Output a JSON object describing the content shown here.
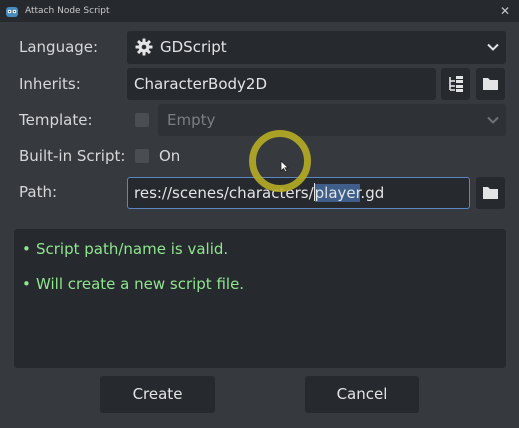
{
  "window": {
    "title": "Attach Node Script",
    "close_glyph": "✕"
  },
  "form": {
    "language": {
      "label": "Language:",
      "value": "GDScript",
      "icon": "gear-icon"
    },
    "inherits": {
      "label": "Inherits:",
      "value": "CharacterBody2D",
      "tree_icon": "class-tree-icon",
      "folder_icon": "folder-icon"
    },
    "template": {
      "label": "Template:",
      "value": "Empty",
      "enabled": false,
      "checked": false
    },
    "builtin": {
      "label": "Built-in Script:",
      "option": "On",
      "checked": false
    },
    "path": {
      "label": "Path:",
      "before": "res://scenes/characters/",
      "selected": "player",
      "after": ".gd",
      "folder_icon": "folder-icon"
    }
  },
  "messages": [
    {
      "bullet": "•",
      "text": "Script path/name is valid."
    },
    {
      "bullet": "•",
      "text": "Will create a new script file."
    }
  ],
  "buttons": {
    "create": "Create",
    "cancel": "Cancel"
  },
  "colors": {
    "background": "#36393e",
    "field": "#26292d",
    "accent": "#3f5f8a",
    "success_text": "#8fe68f",
    "cursor_highlight": "#b7ad25"
  }
}
